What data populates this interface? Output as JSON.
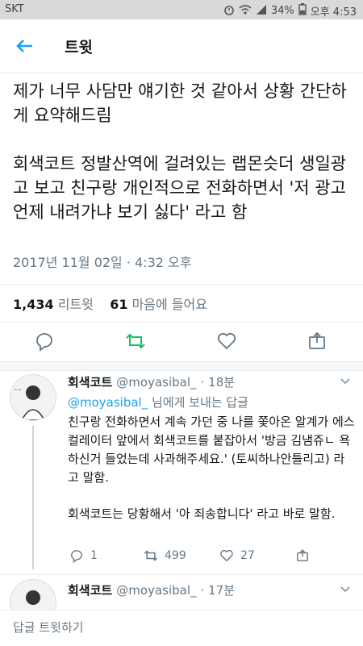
{
  "status_bar": {
    "carrier": "SKT",
    "battery": "34%",
    "time": "오후 4:53"
  },
  "header": {
    "title": "트윗"
  },
  "tweet": {
    "paragraph1": "제가 너무 사담만 얘기한 것 같아서 상황 간단하게 요약해드림",
    "paragraph2": "회색코트 정발산역에 걸려있는 랩몬슷더 생일광고 보고 친구랑 개인적으로 전화하면서 '저 광고 언제 내려가냐 보기 싫다' 라고 함",
    "timestamp": "2017년 11월 02일 · 4:32 오후",
    "retweet_count": "1,434",
    "retweet_label": "리트윗",
    "like_count": "61",
    "like_label": "마음에 들어요"
  },
  "reply1": {
    "name": "회색코트",
    "handle": "@moyasibal_",
    "time": "· 18분",
    "reply_to_handle": "@moyasibal_",
    "reply_to_suffix": "님에게 보내는 답글",
    "body1": "친구랑 전화하면서 계속 가던 중 나를 쫓아온 알계가 에스컬레이터 앞에서 회색코트를 붙잡아서 '방금 김냄쥬ㄴ 욕하신거 들었는데 사과해주세요.' (토씨하나안틀리고) 라고 말함.",
    "body2": "회색코트는 당황해서 '아 죄송합니다' 라고 바로 말함.",
    "reply_count": "1",
    "retweet_count": "499",
    "like_count": "27"
  },
  "reply2": {
    "name": "회색코트",
    "handle": "@moyasibal_",
    "time": "· 17분"
  },
  "footer": {
    "compose_placeholder": "답글 트윗하기"
  },
  "colors": {
    "accent": "#1da1f2",
    "retweet_active": "#17bf63",
    "secondary_text": "#657786"
  }
}
